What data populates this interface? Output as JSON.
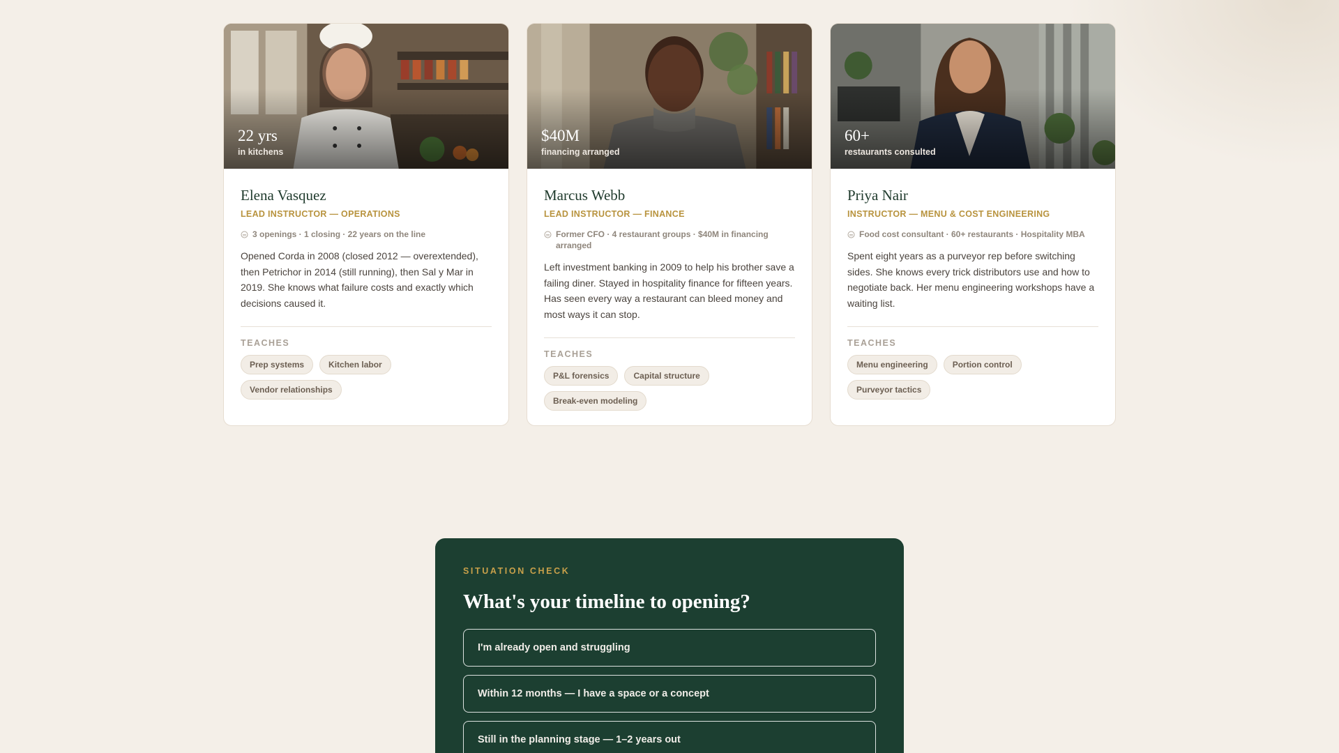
{
  "instructors": [
    {
      "photo_alt": "Elena Vasquez portrait",
      "stat_value": "22 yrs",
      "stat_label": "in kitchens",
      "name": "Elena Vasquez",
      "role": "LEAD INSTRUCTOR — OPERATIONS",
      "meta": "3 openings · 1 closing · 22 years on the line",
      "bio": "Opened Corda in 2008 (closed 2012 — overextended), then Petrichor in 2014 (still running), then Sal y Mar in 2019. She knows what failure costs and exactly which decisions caused it.",
      "teaches_label": "TEACHES",
      "tags": [
        "Prep systems",
        "Kitchen labor",
        "Vendor relationships"
      ]
    },
    {
      "photo_alt": "Marcus Webb portrait",
      "stat_value": "$40M",
      "stat_label": "financing arranged",
      "name": "Marcus Webb",
      "role": "LEAD INSTRUCTOR — FINANCE",
      "meta": "Former CFO · 4 restaurant groups · $40M in financing arranged",
      "bio": "Left investment banking in 2009 to help his brother save a failing diner. Stayed in hospitality finance for fifteen years. Has seen every way a restaurant can bleed money and most ways it can stop.",
      "teaches_label": "TEACHES",
      "tags": [
        "P&L forensics",
        "Capital structure",
        "Break-even modeling"
      ]
    },
    {
      "photo_alt": "Priya Nair portrait",
      "stat_value": "60+",
      "stat_label": "restaurants consulted",
      "name": "Priya Nair",
      "role": "INSTRUCTOR — MENU & COST ENGINEERING",
      "meta": "Food cost consultant · 60+ restaurants · Hospitality MBA",
      "bio": "Spent eight years as a purveyor rep before switching sides. She knows every trick distributors use and how to negotiate back. Her menu engineering workshops have a waiting list.",
      "teaches_label": "TEACHES",
      "tags": [
        "Menu engineering",
        "Portion control",
        "Purveyor tactics"
      ]
    }
  ],
  "quiz": {
    "eyebrow": "SITUATION CHECK",
    "question": "What's your timeline to opening?",
    "options": [
      "I'm already open and struggling",
      "Within 12 months — I have a space or a concept",
      "Still in the planning stage — 1–2 years out"
    ]
  },
  "colors": {
    "page_bg": "#f4efe8",
    "accent_gold": "#b8933e",
    "quiz_bg": "#1c3f31",
    "name_green": "#1f3a2c"
  },
  "icons": [
    "info-circle-icon"
  ]
}
